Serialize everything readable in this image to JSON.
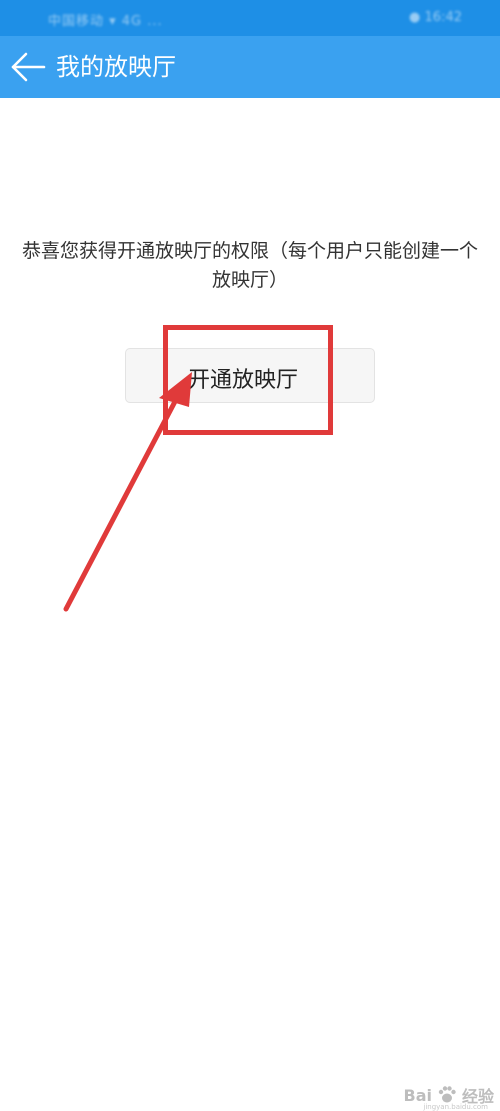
{
  "status_bar": {
    "left_text": "中国移动 ▾ 4G ...",
    "right_text": "● 16:42"
  },
  "app_bar": {
    "back_icon": "arrow-left-icon",
    "title": "我的放映厅"
  },
  "main": {
    "notice_text": "恭喜您获得开通放映厅的权限（每个用户只能创建一个放映厅）",
    "open_button_label": "开通放映厅"
  },
  "annotation": {
    "highlight_color": "#e03a3a"
  },
  "watermark": {
    "brand": "Bai",
    "brand_suffix": "经验",
    "sub": "jingyan.baidu.com"
  },
  "colors": {
    "app_bar": "#3aa1f0",
    "status_bar": "#1e8fe6"
  }
}
